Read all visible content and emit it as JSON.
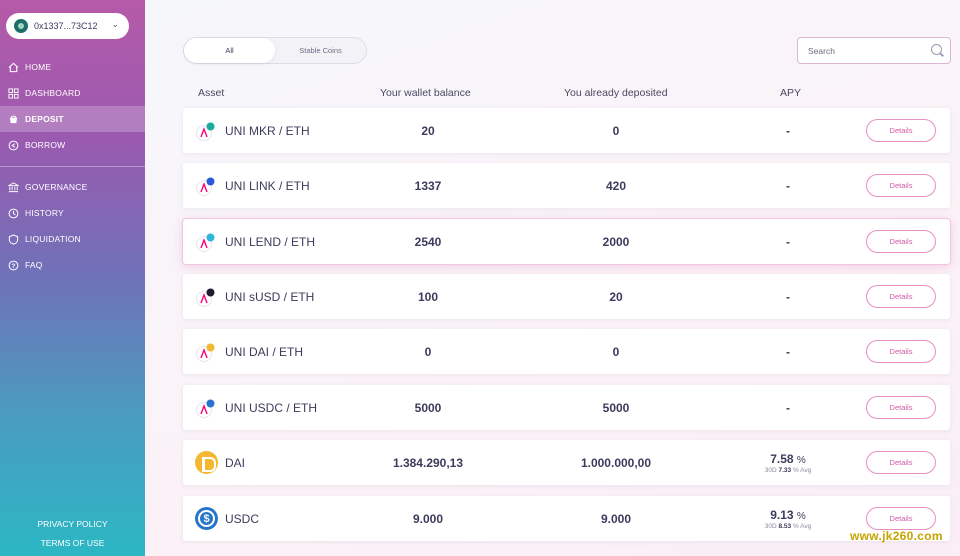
{
  "wallet": {
    "address": "0x1337...73C12"
  },
  "nav": {
    "primary": [
      {
        "label": "HOME",
        "icon": "home-icon"
      },
      {
        "label": "DASHBOARD",
        "icon": "dashboard-icon"
      },
      {
        "label": "DEPOSIT",
        "icon": "deposit-icon",
        "active": true
      },
      {
        "label": "BORROW",
        "icon": "borrow-icon"
      }
    ],
    "secondary": [
      {
        "label": "GOVERNANCE",
        "icon": "governance-icon"
      },
      {
        "label": "HISTORY",
        "icon": "history-icon"
      },
      {
        "label": "LIQUIDATION",
        "icon": "liquidation-icon"
      },
      {
        "label": "FAQ",
        "icon": "faq-icon"
      }
    ]
  },
  "footer": {
    "privacy": "PRIVACY POLICY",
    "terms": "TERMS OF USE"
  },
  "tabs": [
    {
      "label": "All",
      "active": true
    },
    {
      "label": "Stable Coins",
      "active": false
    }
  ],
  "search": {
    "placeholder": "Search"
  },
  "table": {
    "headers": {
      "asset": "Asset",
      "balance": "Your wallet balance",
      "deposited": "You already deposited",
      "apy": "APY"
    },
    "details_label": "Details",
    "rows": [
      {
        "asset": "UNI MKR / ETH",
        "balance": "20",
        "deposited": "0",
        "apy": "-",
        "dot_color": "#1aab9b"
      },
      {
        "asset": "UNI LINK / ETH",
        "balance": "1337",
        "deposited": "420",
        "apy": "-",
        "dot_color": "#2a5ada"
      },
      {
        "asset": "UNI LEND / ETH",
        "balance": "2540",
        "deposited": "2000",
        "apy": "-",
        "dot_color": "#2eb5d8",
        "highlight": true
      },
      {
        "asset": "UNI sUSD / ETH",
        "balance": "100",
        "deposited": "20",
        "apy": "-",
        "dot_color": "#1e1a31"
      },
      {
        "asset": "UNI DAI / ETH",
        "balance": "0",
        "deposited": "0",
        "apy": "-",
        "dot_color": "#f4b731"
      },
      {
        "asset": "UNI USDC / ETH",
        "balance": "5000",
        "deposited": "5000",
        "apy": "-",
        "dot_color": "#2775ca"
      },
      {
        "asset": "DAI",
        "balance": "1.384.290,13",
        "deposited": "1.000.000,00",
        "apy": "7.58",
        "apy_unit": "%",
        "avg_prefix": "30D",
        "avg_value": "7.33",
        "avg_unit": "%",
        "avg_suffix": "Avg"
      },
      {
        "asset": "USDC",
        "balance": "9.000",
        "deposited": "9.000",
        "apy": "9.13",
        "apy_unit": "%",
        "avg_prefix": "30D",
        "avg_value": "8.53",
        "avg_unit": "%",
        "avg_suffix": "Avg"
      }
    ]
  },
  "watermark": "www.jk260.com",
  "colors": {
    "accent": "#d25aa2",
    "sidebar_top": "#b55aa8",
    "sidebar_bottom": "#2bb7c4"
  }
}
